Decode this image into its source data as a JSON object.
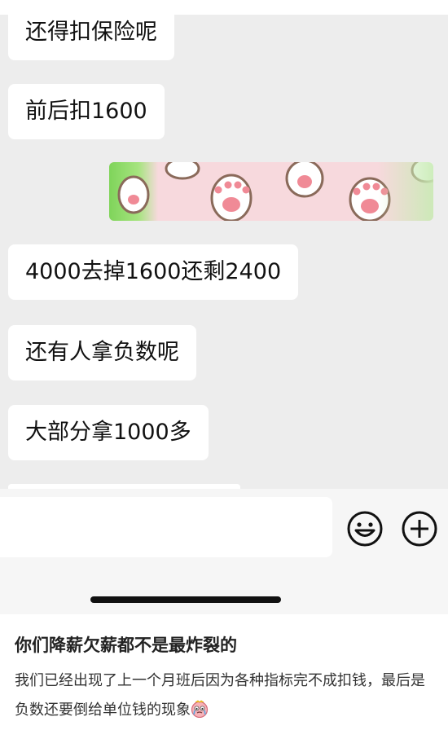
{
  "chat": {
    "messages": [
      {
        "text": "还得扣保险呢"
      },
      {
        "text": "前后扣1600"
      },
      {
        "text": "4000去掉1600还剩2400"
      },
      {
        "text": "还有人拿负数呢"
      },
      {
        "text": "大部分拿1000多"
      }
    ],
    "sticker": {
      "icon": "cat-paw-sticker",
      "colors": {
        "base": "#f7d9dd",
        "green": "#7fd45a",
        "pad": "#f08a96"
      }
    }
  },
  "input_bar": {
    "emoji_icon": "smiley-icon",
    "plus_icon": "plus-circle-icon"
  },
  "post": {
    "title": "你们降薪欠薪都不是最炸裂的",
    "body": "我们已经出现了上一个月班后因为各种指标完不成扣钱，最后是负数还要倒给单位钱的现象",
    "emoji_icon": "crying-face-icon"
  }
}
